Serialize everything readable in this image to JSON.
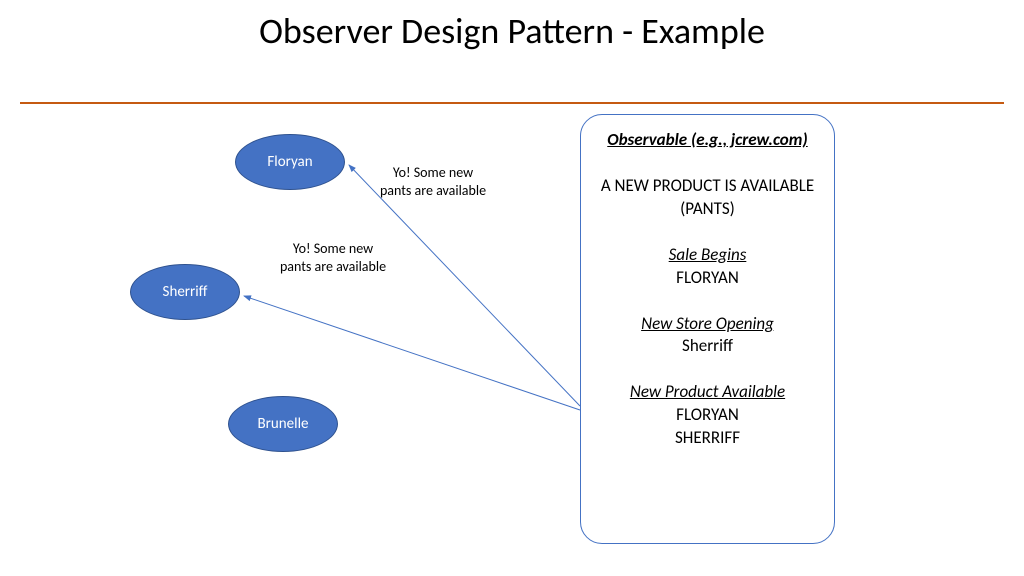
{
  "title": "Observer Design Pattern - Example",
  "nodes": {
    "floryan": "Floryan",
    "sherriff": "Sherriff",
    "brunelle": "Brunelle"
  },
  "messages": {
    "msg1": "Yo! Some new pants are available",
    "msg2": "Yo! Some new pants are available"
  },
  "box": {
    "heading": "Observable (e.g., jcrew.com)",
    "notice": "A NEW PRODUCT IS AVAILABLE (PANTS)",
    "evt1_title": "Sale Begins",
    "evt1_sub": "FLORYAN",
    "evt2_title": "New Store Opening",
    "evt2_sub": "Sherriff",
    "evt3_title": "New Product Available",
    "evt3_sub1": "FLORYAN",
    "evt3_sub2": "SHERRIFF"
  }
}
